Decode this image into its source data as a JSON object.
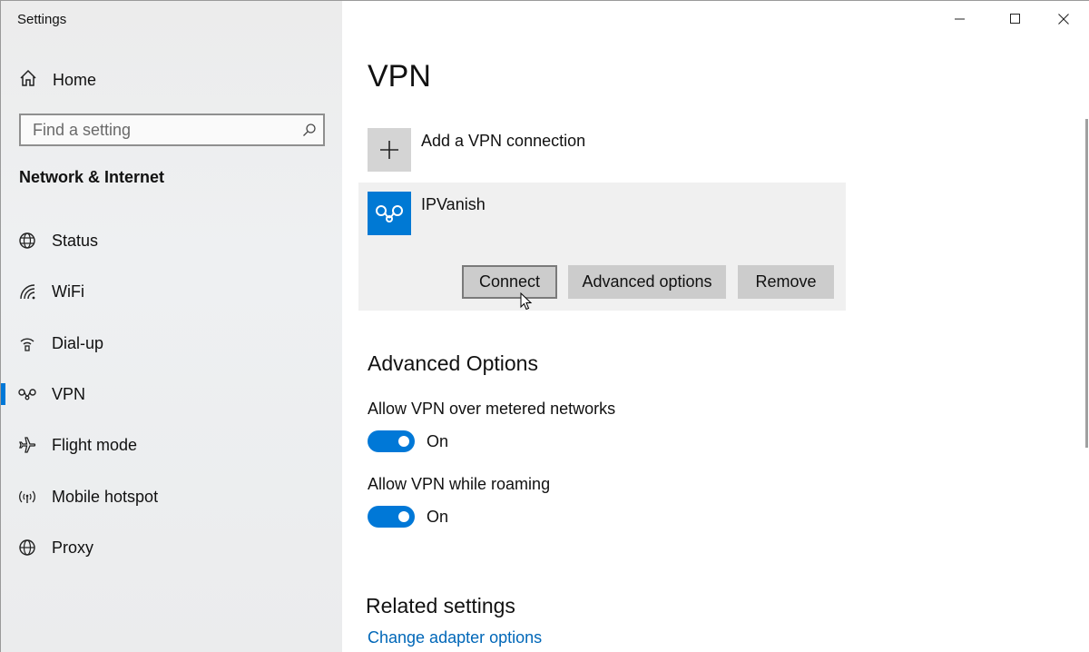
{
  "window": {
    "app_title": "Settings",
    "controls": {
      "minimize": "minimize",
      "maximize": "maximize",
      "close": "close"
    }
  },
  "sidebar": {
    "home_label": "Home",
    "search_placeholder": "Find a setting",
    "section_title": "Network & Internet",
    "items": [
      {
        "label": "Status",
        "icon": "globe-icon",
        "active": false
      },
      {
        "label": "WiFi",
        "icon": "wifi-icon",
        "active": false
      },
      {
        "label": "Dial-up",
        "icon": "dialup-icon",
        "active": false
      },
      {
        "label": "VPN",
        "icon": "vpn-icon",
        "active": true
      },
      {
        "label": "Flight mode",
        "icon": "airplane-icon",
        "active": false
      },
      {
        "label": "Mobile hotspot",
        "icon": "hotspot-icon",
        "active": false
      },
      {
        "label": "Proxy",
        "icon": "globe-icon",
        "active": false
      }
    ]
  },
  "main": {
    "title": "VPN",
    "add_vpn_label": "Add a VPN connection",
    "connection": {
      "name": "IPVanish",
      "buttons": {
        "connect": "Connect",
        "advanced": "Advanced options",
        "remove": "Remove"
      }
    },
    "advanced_options": {
      "heading": "Advanced Options",
      "metered": {
        "label": "Allow VPN over metered networks",
        "state": "On"
      },
      "roaming": {
        "label": "Allow VPN while roaming",
        "state": "On"
      }
    },
    "related": {
      "heading": "Related settings",
      "link": "Change adapter options"
    }
  },
  "colors": {
    "accent": "#0078d7",
    "link": "#0067b8",
    "logo_bg": "#0079d4"
  }
}
